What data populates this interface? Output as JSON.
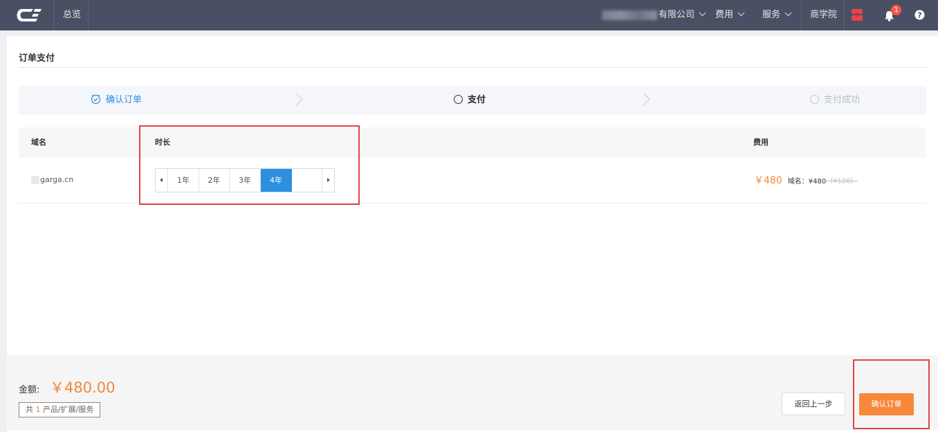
{
  "topbar": {
    "logo_text": "CE",
    "overview": "总览",
    "company_suffix": "有限公司",
    "cost": "费用",
    "service": "服务",
    "academy": "商学院",
    "notification_count": "1",
    "help_symbol": "?"
  },
  "page": {
    "title": "订单支付"
  },
  "steps": [
    {
      "label": "确认订单",
      "state": "done"
    },
    {
      "label": "支付",
      "state": "active"
    },
    {
      "label": "支付成功",
      "state": "pending"
    }
  ],
  "table": {
    "headers": {
      "domain": "域名",
      "duration": "时长",
      "cost": "费用"
    },
    "row": {
      "domain_visible": "garga.cn",
      "duration_options": [
        "1年",
        "2年",
        "3年",
        "4年"
      ],
      "selected_index": 3,
      "price": "￥480",
      "price_note": "域名：¥480",
      "price_old": "（¥120）"
    }
  },
  "footer": {
    "amount_label": "金额:",
    "amount_value": "￥480.00",
    "count_prefix": "共",
    "count_num": "1",
    "count_suffix": "产品/扩展/服务",
    "back_label": "返回上一步",
    "confirm_label": "确认订单"
  },
  "colors": {
    "topbar_bg": "#4a5064",
    "accent_orange": "#f7883a",
    "selected_blue": "#2d8fe0",
    "highlight_red": "#e04444",
    "step_done_blue": "#2d8fe0"
  },
  "icons": {
    "logo": "ce-logo-icon",
    "store": "store-icon",
    "bell": "bell-icon",
    "help": "help-icon",
    "step_done": "clock-check-icon",
    "step_active": "circle-icon",
    "step_pending": "circle-icon"
  }
}
